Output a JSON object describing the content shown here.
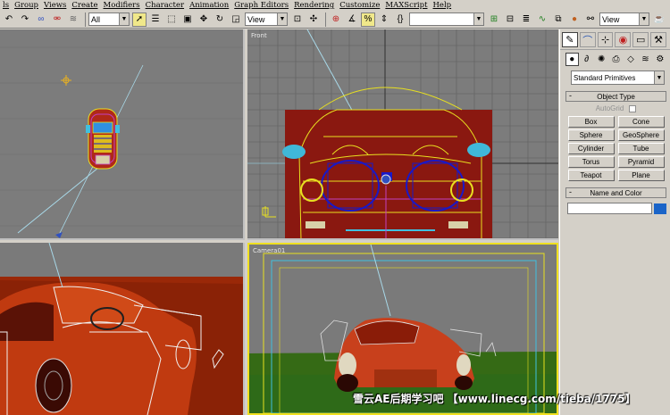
{
  "menu": [
    "ls",
    "Group",
    "Views",
    "Create",
    "Modifiers",
    "Character",
    "Animation",
    "Graph Editors",
    "Rendering",
    "Customize",
    "MAXScript",
    "Help"
  ],
  "toolbar": {
    "selection_filter": "All",
    "ref_coord_left": "View",
    "named_selection": "",
    "ref_coord_right": "View"
  },
  "viewports": {
    "top": {
      "label": ""
    },
    "front": {
      "label": "Front"
    },
    "perspective": {
      "label": ""
    },
    "camera": {
      "label": "Camera01"
    }
  },
  "command_panel": {
    "category_dropdown": "Standard Primitives",
    "object_type": {
      "title": "Object Type",
      "autogrid": "AutoGrid",
      "buttons": [
        "Box",
        "Cone",
        "Sphere",
        "GeoSphere",
        "Cylinder",
        "Tube",
        "Torus",
        "Pyramid",
        "Teapot",
        "Plane"
      ]
    },
    "name_and_color": {
      "title": "Name and Color",
      "name_value": "",
      "color": "#1a64c8"
    },
    "toggle_minus": "-"
  },
  "watermark": "雪云AE后期学习吧 【www.linecg.com/tieba/1775】",
  "colors": {
    "grid_line": "#606060",
    "viewport_bg": "#7c7c7c",
    "active_border": "#f0e020",
    "wire_yellow": "#e8e020",
    "wire_blue": "#1818c8",
    "car_red": "#c03010"
  }
}
